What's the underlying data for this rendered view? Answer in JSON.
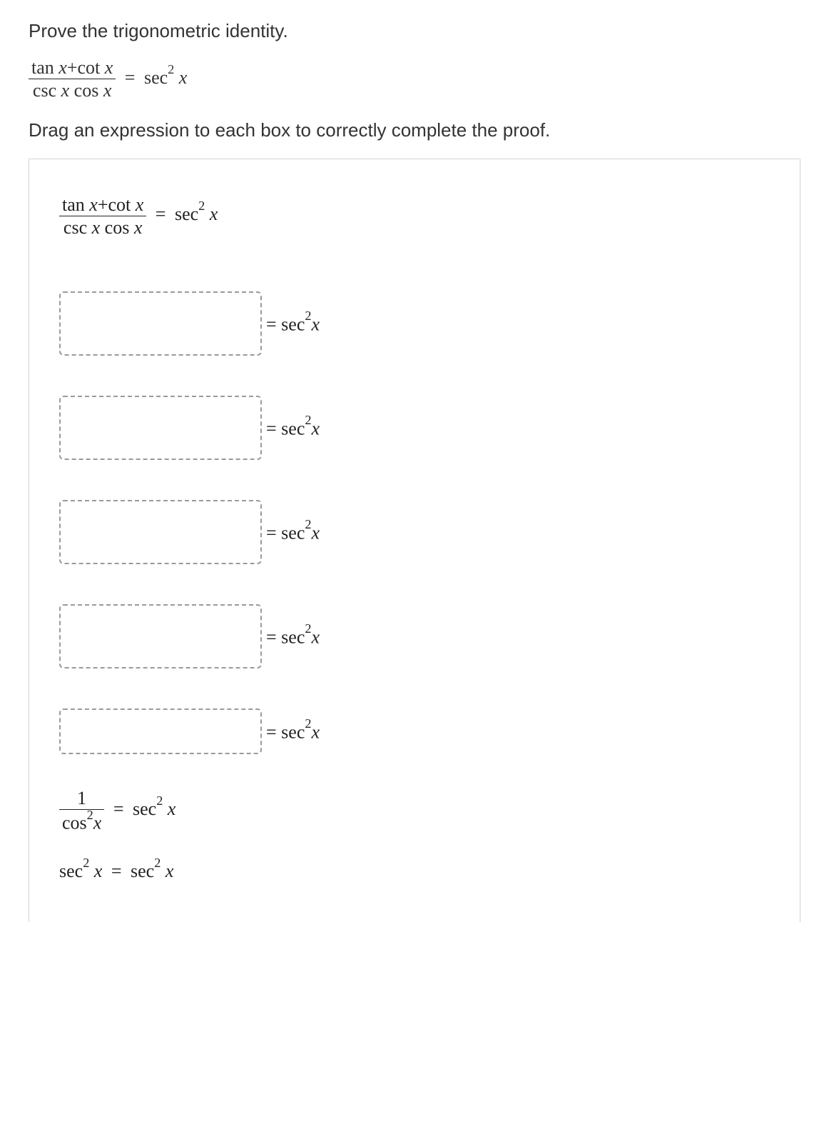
{
  "instruction": "Prove the trigonometric identity.",
  "subinstruction": "Drag an expression to each box to correctly complete the proof.",
  "eq": {
    "lhs_num": "tan x+cot x",
    "lhs_den": "csc x cos x",
    "eq_sign": "=",
    "rhs": "sec² x"
  },
  "drop_rhs": "= sec²x",
  "final1": {
    "frac_num": "1",
    "frac_den": "cos²x",
    "eq_sign": "=",
    "rhs": "sec² x"
  },
  "final2": {
    "lhs": "sec² x",
    "eq_sign": "=",
    "rhs": "sec² x"
  }
}
